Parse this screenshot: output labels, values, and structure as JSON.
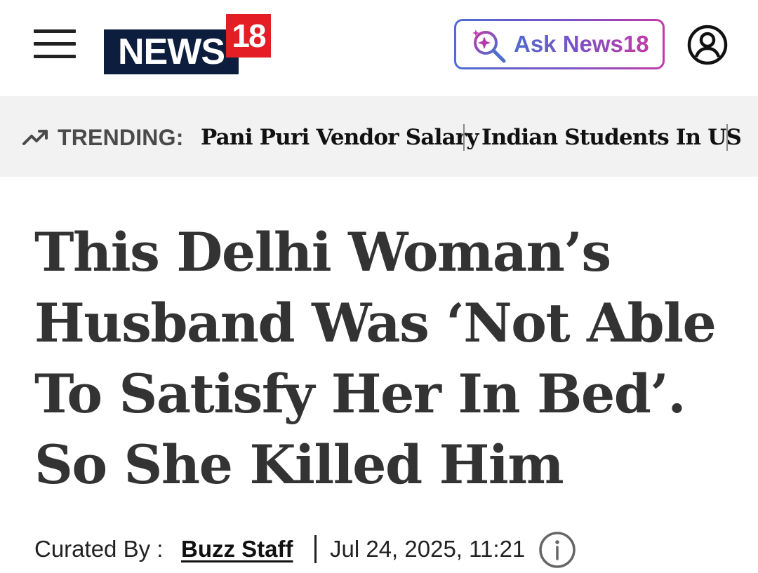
{
  "header": {
    "menu_icon": "hamburger-menu-icon",
    "logo": {
      "text": "NEWS",
      "number": "18",
      "colors": {
        "main": "#0c1d3d",
        "accent": "#e31e24"
      }
    },
    "ask_button": {
      "label": "Ask News18",
      "icon": "sparkle-search-icon",
      "gradient": [
        "#4f6ccf",
        "#7b52c6",
        "#c23aa7"
      ]
    },
    "profile_icon": "user-profile-icon"
  },
  "trending": {
    "icon": "trending-up-icon",
    "label": "TRENDING:",
    "items": [
      {
        "label": "Pani Puri Vendor Salary"
      },
      {
        "label": "Indian Students In US"
      }
    ]
  },
  "article": {
    "headline": "This Delhi Woman’s Husband Was ‘Not Able To Satisfy Her In Bed’. So She Killed Him",
    "byline": {
      "label": "Curated By :",
      "author": "Buzz Staff",
      "date": "Jul 24, 2025, 11:21",
      "info_icon": "info-icon"
    }
  }
}
